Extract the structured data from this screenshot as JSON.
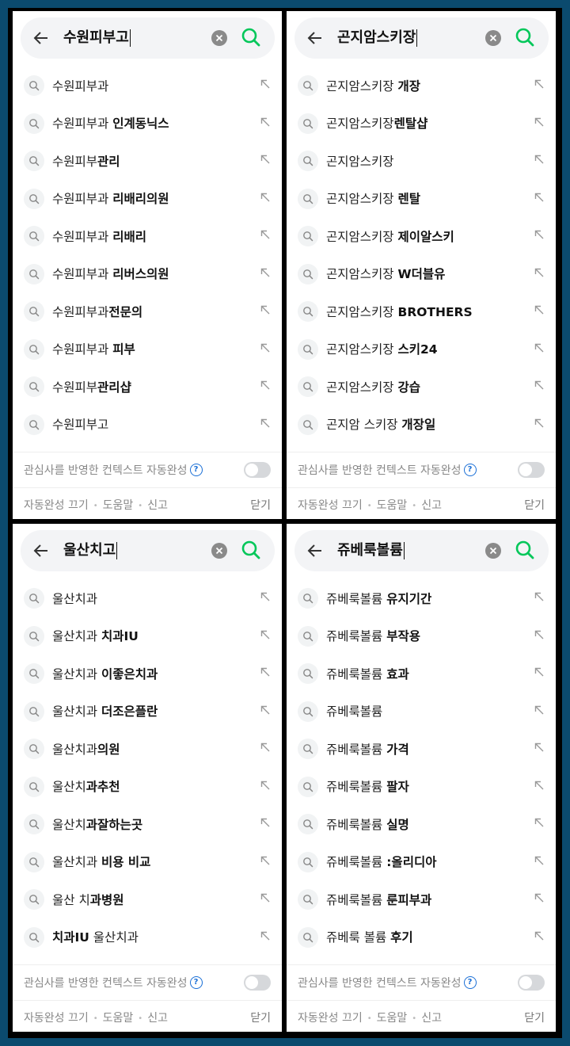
{
  "colors": {
    "accent": "#03c75a",
    "help": "#1a6fd6",
    "background": "#0b4a6e"
  },
  "panels": [
    {
      "query": "수원피부고",
      "suggestions": [
        {
          "prefix": "수원피부과",
          "suffix": ""
        },
        {
          "prefix": "수원피부과 ",
          "suffix": "인계동닉스"
        },
        {
          "prefix": "수원피부",
          "suffix": "관리"
        },
        {
          "prefix": "수원피부과 ",
          "suffix": "리배리의원"
        },
        {
          "prefix": "수원피부과 ",
          "suffix": "리배리"
        },
        {
          "prefix": "수원피부과 ",
          "suffix": "리버스의원"
        },
        {
          "prefix": "수원피부과",
          "suffix": "전문의"
        },
        {
          "prefix": "수원피부과 ",
          "suffix": "피부"
        },
        {
          "prefix": "수원피부",
          "suffix": "관리샵"
        },
        {
          "prefix": "수원피부고",
          "suffix": ""
        }
      ],
      "context_label": "관심사를 반영한 컨텍스트 자동완성",
      "footer": {
        "autocomplete_off": "자동완성 끄기",
        "help": "도움말",
        "report": "신고",
        "close": "닫기"
      }
    },
    {
      "query": "곤지암스키장",
      "suggestions": [
        {
          "prefix": "곤지암스키장 ",
          "suffix": "개장"
        },
        {
          "prefix": "곤지암스키장",
          "suffix": "렌탈샵"
        },
        {
          "prefix": "곤지암스키장",
          "suffix": ""
        },
        {
          "prefix": "곤지암스키장 ",
          "suffix": "렌탈"
        },
        {
          "prefix": "곤지암스키장 ",
          "suffix": "제이알스키"
        },
        {
          "prefix": "곤지암스키장 ",
          "suffix": "W더블유"
        },
        {
          "prefix": "곤지암스키장 ",
          "suffix": "BROTHERS"
        },
        {
          "prefix": "곤지암스키장 ",
          "suffix": "스키24"
        },
        {
          "prefix": "곤지암스키장 ",
          "suffix": "강습"
        },
        {
          "prefix": "곤지암 스키장 ",
          "suffix": "개장일"
        }
      ],
      "context_label": "관심사를 반영한 컨텍스트 자동완성",
      "footer": {
        "autocomplete_off": "자동완성 끄기",
        "help": "도움말",
        "report": "신고",
        "close": "닫기"
      }
    },
    {
      "query": "울산치고",
      "suggestions": [
        {
          "prefix": "울산치과",
          "suffix": ""
        },
        {
          "prefix": "울산치과 ",
          "suffix": "치과IU"
        },
        {
          "prefix": "울산치과 ",
          "suffix": "이좋은치과"
        },
        {
          "prefix": "울산치과 ",
          "suffix": "더조은플란"
        },
        {
          "prefix": "울산치과",
          "suffix": "의원"
        },
        {
          "prefix": "울산치",
          "suffix": "과추천"
        },
        {
          "prefix": "울산치",
          "suffix": "과잘하는곳"
        },
        {
          "prefix": "울산치과 ",
          "suffix": "비용 비교"
        },
        {
          "prefix": "울산 치",
          "suffix": "과병원"
        },
        {
          "prefix": "",
          "suffix": "치과IU",
          "tail": " 울산치과"
        }
      ],
      "context_label": "관심사를 반영한 컨텍스트 자동완성",
      "footer": {
        "autocomplete_off": "자동완성 끄기",
        "help": "도움말",
        "report": "신고",
        "close": "닫기"
      }
    },
    {
      "query": "쥬베룩볼륨",
      "suggestions": [
        {
          "prefix": "쥬베룩볼륨 ",
          "suffix": "유지기간"
        },
        {
          "prefix": "쥬베룩볼륨 ",
          "suffix": "부작용"
        },
        {
          "prefix": "쥬베룩볼륨 ",
          "suffix": "효과"
        },
        {
          "prefix": "쥬베룩볼륨",
          "suffix": ""
        },
        {
          "prefix": "쥬베룩볼륨 ",
          "suffix": "가격"
        },
        {
          "prefix": "쥬베룩볼륨 ",
          "suffix": "팔자"
        },
        {
          "prefix": "쥬베룩볼륨 ",
          "suffix": "실명"
        },
        {
          "prefix": "쥬베룩볼륨 ",
          "suffix": ":올리디아"
        },
        {
          "prefix": "쥬베룩볼륨 ",
          "suffix": "룬피부과"
        },
        {
          "prefix": "쥬베룩 볼륨 ",
          "suffix": "후기"
        }
      ],
      "context_label": "관심사를 반영한 컨텍스트 자동완성",
      "footer": {
        "autocomplete_off": "자동완성 끄기",
        "help": "도움말",
        "report": "신고",
        "close": "닫기"
      }
    }
  ]
}
